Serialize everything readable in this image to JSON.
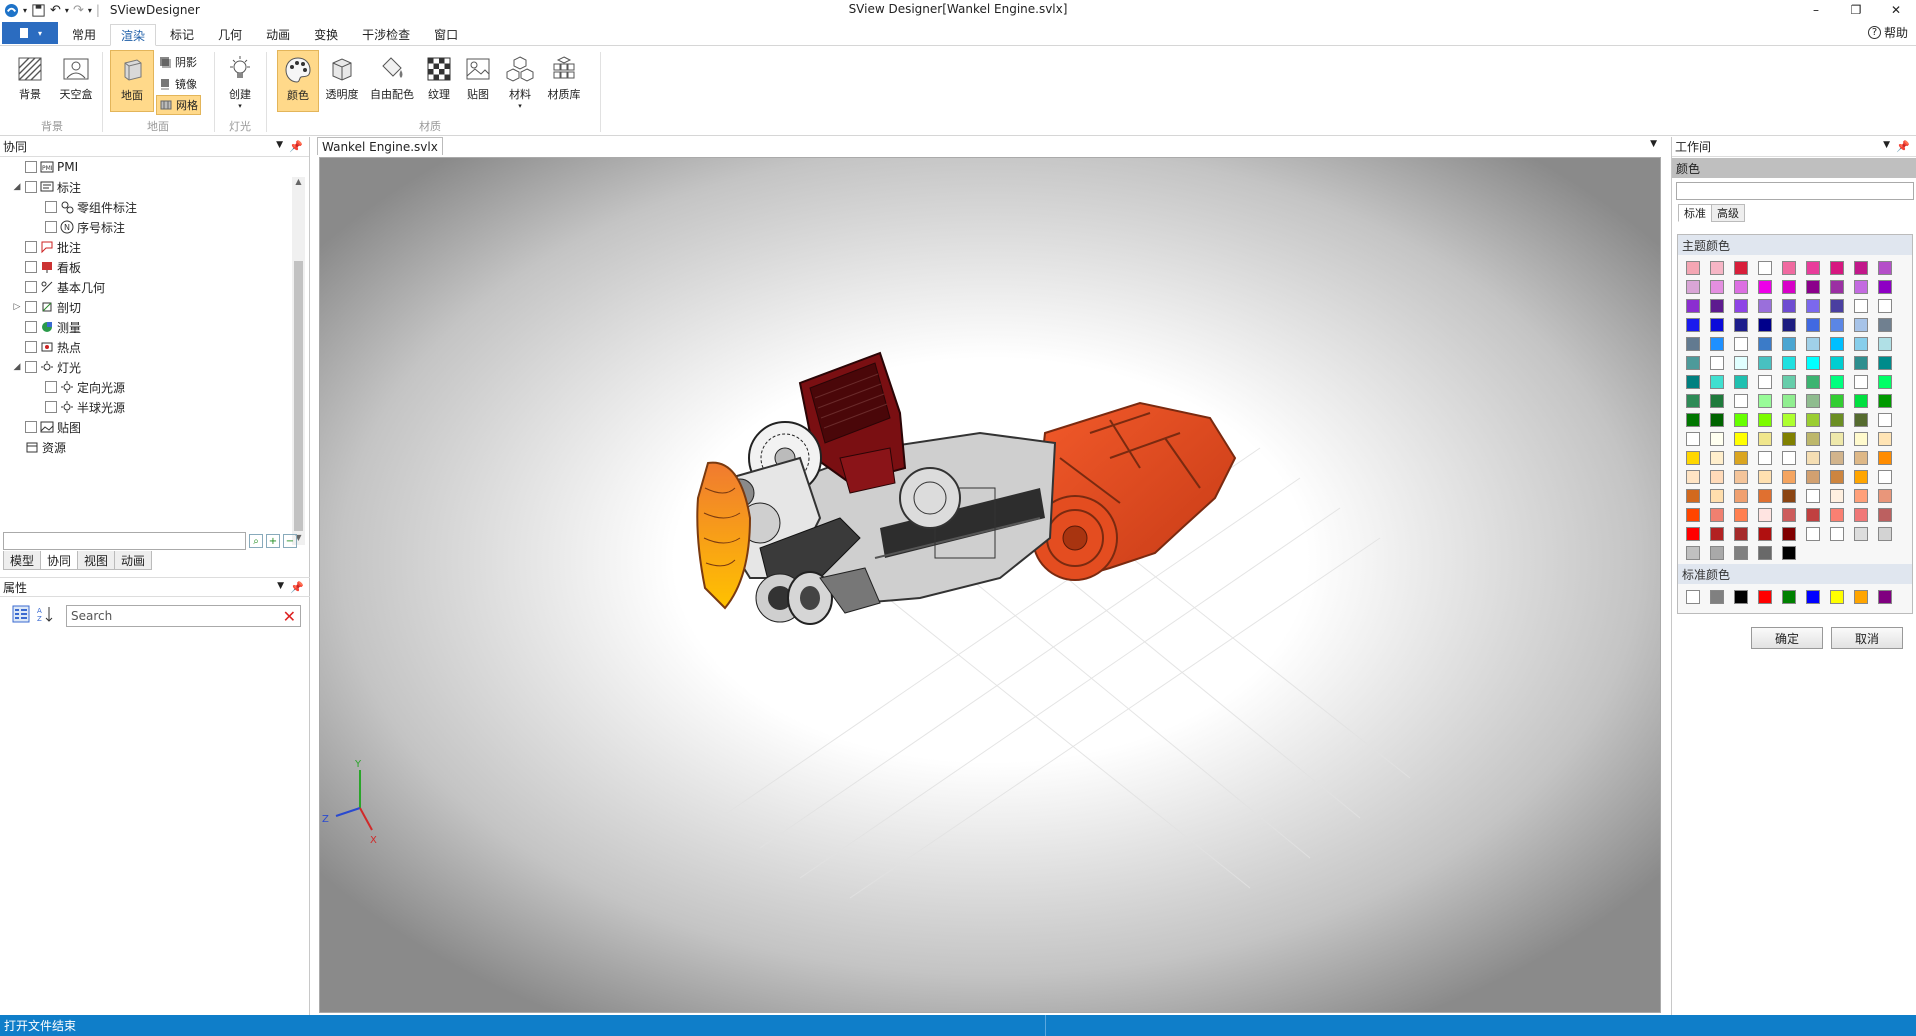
{
  "titlebar": {
    "app_name": "SViewDesigner",
    "window_title": "SView Designer[Wankel Engine.svlx]"
  },
  "ribbon_tabs": [
    {
      "label": "常用"
    },
    {
      "label": "渲染"
    },
    {
      "label": "标记"
    },
    {
      "label": "几何"
    },
    {
      "label": "动画"
    },
    {
      "label": "变换"
    },
    {
      "label": "干涉检查"
    },
    {
      "label": "窗口"
    }
  ],
  "help_label": "帮助",
  "ribbon": {
    "bg": {
      "group": "背景",
      "btn1": "背景",
      "btn2": "天空盒"
    },
    "ground": {
      "group": "地面",
      "big": "地面",
      "shadow": "阴影",
      "mirror": "镜像",
      "grid": "网格"
    },
    "light": {
      "group": "灯光",
      "create": "创建"
    },
    "material": {
      "group": "材质",
      "color": "颜色",
      "transparency": "透明度",
      "freecolor": "自由配色",
      "texture": "纹理",
      "decal": "贴图",
      "mat": "材料",
      "lib": "材质库"
    }
  },
  "left": {
    "title": "协同",
    "tree": [
      {
        "label": "PMI",
        "indent": 0
      },
      {
        "label": "标注",
        "indent": 0,
        "expanded": true
      },
      {
        "label": "零组件标注",
        "indent": 1
      },
      {
        "label": "序号标注",
        "indent": 1
      },
      {
        "label": "批注",
        "indent": 0
      },
      {
        "label": "看板",
        "indent": 0
      },
      {
        "label": "基本几何",
        "indent": 0
      },
      {
        "label": "剖切",
        "indent": 0,
        "collapsed": true
      },
      {
        "label": "测量",
        "indent": 0
      },
      {
        "label": "热点",
        "indent": 0
      },
      {
        "label": "灯光",
        "indent": 0,
        "expanded": true
      },
      {
        "label": "定向光源",
        "indent": 1
      },
      {
        "label": "半球光源",
        "indent": 1
      },
      {
        "label": "贴图",
        "indent": 0
      },
      {
        "label": "资源",
        "indent": 0
      }
    ],
    "bottom_tabs": [
      "模型",
      "协同",
      "视图",
      "动画"
    ],
    "props_title": "属性",
    "props_search_placeholder": "Search"
  },
  "document": {
    "tab": "Wankel Engine.svlx"
  },
  "axis": {
    "y": "Y",
    "z": "Z",
    "x": "X"
  },
  "right": {
    "title": "工作间",
    "color_title": "颜色",
    "tabs": [
      "标准",
      "高级"
    ],
    "theme_label": "主题颜色",
    "standard_label": "标准颜色",
    "ok": "确定",
    "cancel": "取消",
    "theme_colors": [
      "#f4a6b3",
      "#f6b5c5",
      "#d81e3a",
      "#ffffff",
      "#f06aa0",
      "#e83d9b",
      "#d61780",
      "#c2188a",
      "#b54fc9",
      "#d9a5d6",
      "#e48fe0",
      "#dc6fe2",
      "#ee00e8",
      "#d800c8",
      "#8b008b",
      "#9b2fa3",
      "#c36ae0",
      "#8e00c4",
      "#8b2ed0",
      "#5d1b8f",
      "#8e44e6",
      "#9a6fdb",
      "#6e4cd1",
      "#7b68ee",
      "#4a3fa0",
      "#ffffff",
      "#ffffff",
      "#1a1aee",
      "#0b0bd9",
      "#1d1d8b",
      "#00008b",
      "#1d1d80",
      "#4169e1",
      "#5b86e5",
      "#a7c3e8",
      "#708090",
      "#627a90",
      "#1e90ff",
      "#ffffff",
      "#3b7bc8",
      "#4aa5d1",
      "#a0d0e8",
      "#00bfff",
      "#87ceeb",
      "#b0e0e6",
      "#4d9a9a",
      "#ffffff",
      "#e0ffff",
      "#48c0c0",
      "#20e0e0",
      "#00ffff",
      "#00ced1",
      "#2f8f8f",
      "#008b8b",
      "#008080",
      "#40e0d0",
      "#20c0b0",
      "#ffffff",
      "#66cdaa",
      "#3cb371",
      "#00ff7f",
      "#ffffff",
      "#00ff66",
      "#2e8b57",
      "#1f7a3c",
      "#ffffff",
      "#98fb98",
      "#90ee90",
      "#8fbc8f",
      "#32cd32",
      "#00e040",
      "#009900",
      "#007700",
      "#006400",
      "#66ff00",
      "#7cfc00",
      "#adff2f",
      "#9acd32",
      "#6b8e23",
      "#556b2f",
      "#ffffff",
      "#ffffff",
      "#fffff0",
      "#ffff00",
      "#f0e68c",
      "#808000",
      "#bdb76b",
      "#eee8aa",
      "#fffacd",
      "#ffe4b5",
      "#ffd700",
      "#ffeecc",
      "#daa520",
      "#ffffff",
      "#ffffff",
      "#f5deb3",
      "#d2b48c",
      "#deb887",
      "#ff8c00",
      "#ffe4c4",
      "#ffdab9",
      "#f4c49a",
      "#ffe0b0",
      "#f4a460",
      "#d2a070",
      "#cd853f",
      "#ffa500",
      "#ffffff",
      "#d2691e",
      "#ffdead",
      "#f0a070",
      "#e07030",
      "#8b4513",
      "#ffffff",
      "#fff0e0",
      "#ffa07a",
      "#e9967a",
      "#ff4500",
      "#f08070",
      "#ff7f50",
      "#ffe4e1",
      "#cd5c5c",
      "#c04040",
      "#fa8072",
      "#f07878",
      "#bc6060",
      "#ff0000",
      "#b22222",
      "#a52a2a",
      "#b01010",
      "#800000",
      "#ffffff",
      "#ffffff",
      "#dddddd",
      "#d3d3d3",
      "#c0c0c0",
      "#a9a9a9",
      "#808080",
      "#696969",
      "#000000"
    ],
    "standard_colors": [
      "#ffffff",
      "#808080",
      "#000000",
      "#ff0000",
      "#008000",
      "#0000ff",
      "#ffff00",
      "#ffa500",
      "#800080"
    ]
  },
  "status": {
    "text": "打开文件结束"
  },
  "colors": {
    "accent": "#2b6cc0",
    "status_bar": "#0f7ec9",
    "selected": "#ffd98a"
  }
}
